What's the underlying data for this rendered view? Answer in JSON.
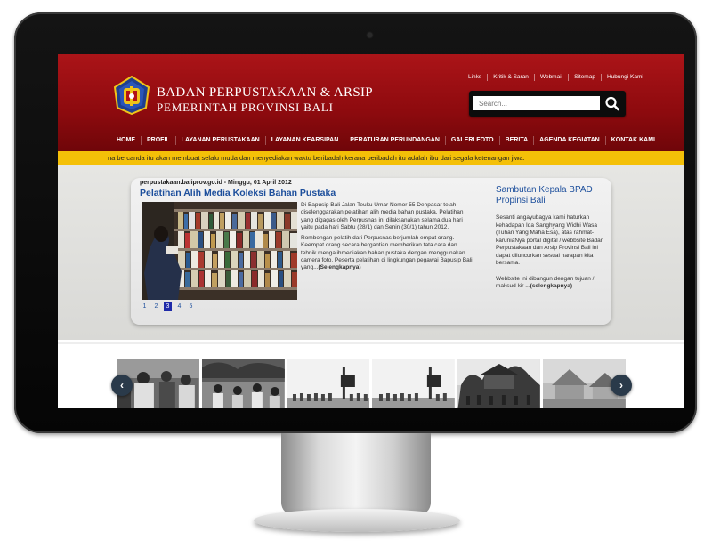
{
  "header": {
    "title": "BADAN PERPUSTAKAAN & ARSIP",
    "subtitle": "PEMERINTAH PROVINSI BALI",
    "logo_icon": "provincial-crest-icon",
    "brand_color": "#9e1015",
    "accent_color": "#f4c008"
  },
  "top_links": [
    "Links",
    "Kritik & Saran",
    "Webmail",
    "Sitemap",
    "Hubungi Kami"
  ],
  "search": {
    "placeholder": "Search...",
    "icon": "search-icon"
  },
  "nav": [
    "HOME",
    "PROFIL",
    "LAYANAN PERUSTAKAAN",
    "LAYANAN KEARSIPAN",
    "PERATURAN PERUNDANGAN",
    "GALERI FOTO",
    "BERITA",
    "AGENDA KEGIATAN",
    "KONTAK KAMI"
  ],
  "ticker": "na bercanda itu akan membuat selalu muda dan menyediakan waktu beribadah kerana beribadah itu adalah ibu dari segala ketenangan jiwa.",
  "news": {
    "meta": "perpustakaan.baliprov.go.id - Minggu, 01 April 2012",
    "title": "Pelatihan Alih Media Koleksi Bahan Pustaka",
    "p1": "Di Bapusip Bali Jalan Teuku Umar Nomor 55 Denpasar telah diselenggarakan pelatihan alih media bahan pustaka. Pelatihan yang digagas oleh Perpusnas ini dilaksanakan selama dua hari yaitu pada hari Sabtu (28/1) dan Senin (30/1) tahun 2012.",
    "p2": "Rombongan pelatih dari Perpusnas berjumlah empat orang. Keempat orang secara bergantian memberikan tata cara dan tehnik mengalihmediakan bahan pustaka dengan menggunakan camera foto. Peserta pelatihan di lingkungan pegawai Bapusip Bali yang...",
    "more": "(Selengkapnya)",
    "pages": [
      "1",
      "2",
      "3",
      "4",
      "5"
    ],
    "active_page": "3"
  },
  "side": {
    "title": "Sambutan Kepala BPAD Propinsi Bali",
    "p1": "Sesanti angayubagya kami haturkan kehadapan Ida Sanghyang Widhi Wasa (Tuhan Yang Maha Esa), atas rahmat-karuniaNya portal digital / webbsite Badan Perpustakaan dan Arsip Provinsi Bali ini dapat diluncurkan sesuai harapan kita bersama.",
    "p2": "Webbsite ini dibangun dengan tujuan / maksud kir ...",
    "more": "(selengkapnya)"
  },
  "carousel": {
    "prev_label": "‹",
    "next_label": "›",
    "thumbnails": [
      "gallery-photo-ceremony",
      "gallery-photo-children",
      "gallery-photo-field-1",
      "gallery-photo-field-2",
      "gallery-photo-temple",
      "gallery-photo-village"
    ]
  }
}
